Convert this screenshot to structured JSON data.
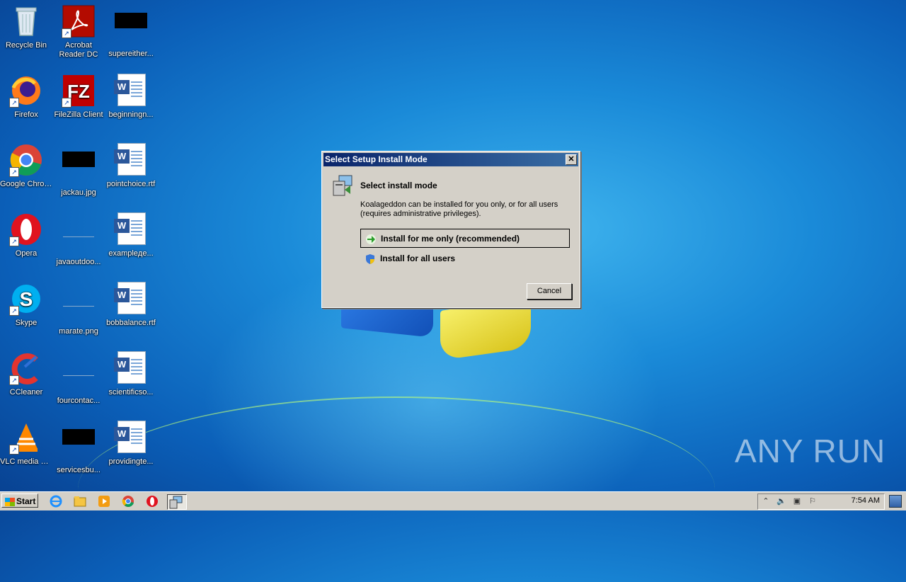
{
  "desktop": {
    "icons": [
      {
        "label": "Recycle Bin"
      },
      {
        "label": "Acrobat Reader DC"
      },
      {
        "label": "supereither..."
      },
      {
        "label": "Firefox"
      },
      {
        "label": "FileZilla Client"
      },
      {
        "label": "beginningn..."
      },
      {
        "label": "Google Chrome"
      },
      {
        "label": "jackau.jpg"
      },
      {
        "label": "pointchoice.rtf"
      },
      {
        "label": "Opera"
      },
      {
        "label": "javaoutdoo..."
      },
      {
        "label": "exampleде..."
      },
      {
        "label": "Skype"
      },
      {
        "label": "marate.png"
      },
      {
        "label": "bobbalance.rtf"
      },
      {
        "label": "CCleaner"
      },
      {
        "label": "fourcontac..."
      },
      {
        "label": "scientificso..."
      },
      {
        "label": "VLC media player"
      },
      {
        "label": "servicesbu..."
      },
      {
        "label": "providingte..."
      }
    ]
  },
  "dialog": {
    "title": "Select Setup Install Mode",
    "heading": "Select install mode",
    "description": "Koalageddon can be installed for you only, or for all users (requires administrative privileges).",
    "option_me": "Install for me only (recommended)",
    "option_all": "Install for all users",
    "cancel_label": "Cancel"
  },
  "taskbar": {
    "start_label": "Start",
    "clock": "7:54 AM",
    "pinned": [
      "ie-icon",
      "explorer-icon",
      "media-player-icon",
      "chrome-icon",
      "opera-icon",
      "setup-icon"
    ]
  },
  "watermark": "ANY RUN",
  "colors": {
    "titlebar": "#0a246a",
    "dialog_bg": "#d4d0c8",
    "taskbar_bg": "#d4d0c8"
  }
}
